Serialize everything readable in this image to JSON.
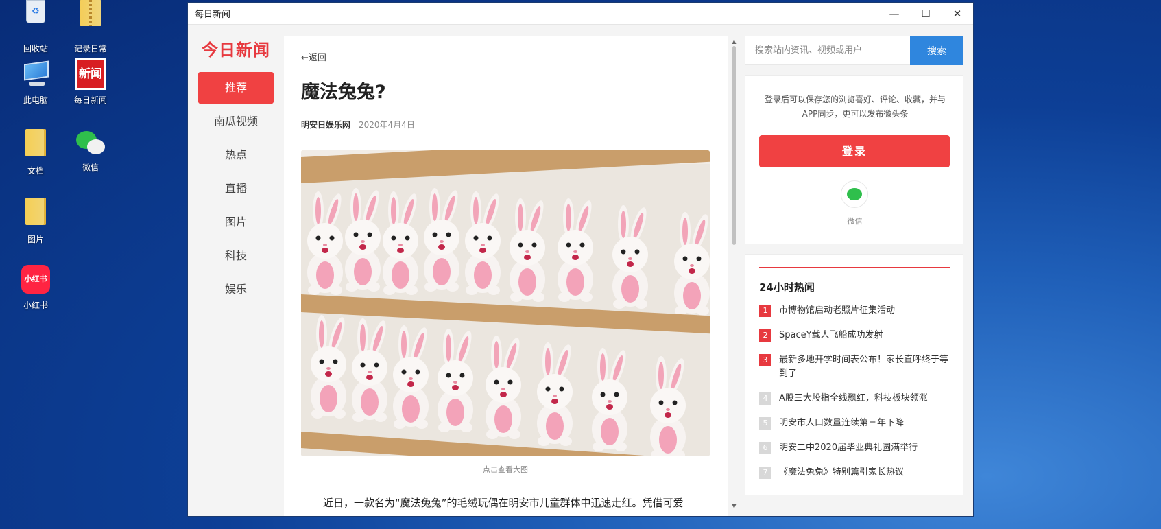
{
  "desktop": {
    "icons": [
      {
        "label": "回收站"
      },
      {
        "label": "记录日常"
      },
      {
        "label": "此电脑"
      },
      {
        "label": "每日新闻"
      },
      {
        "label": "文档"
      },
      {
        "label": "微信"
      },
      {
        "label": "图片"
      },
      {
        "label": "小红书"
      }
    ],
    "news_logo_text": "新闻",
    "xhs_logo_text": "小红书"
  },
  "window": {
    "title": "每日新闻",
    "controls": {
      "minimize": "—",
      "maximize": "☐",
      "close": "✕"
    }
  },
  "leftnav": {
    "brand": "今日新闻",
    "items": [
      {
        "label": "推荐",
        "active": true
      },
      {
        "label": "南瓜视频"
      },
      {
        "label": "热点"
      },
      {
        "label": "直播"
      },
      {
        "label": "图片"
      },
      {
        "label": "科技"
      },
      {
        "label": "娱乐"
      }
    ]
  },
  "article": {
    "back_label": "返回",
    "title": "魔法兔兔?",
    "source": "明安日娱乐网",
    "date": "2020年4月4日",
    "image_caption": "点击查看大图",
    "first_paragraph": "近日，一款名为“魔法兔兔”的毛绒玩偶在明安市儿童群体中迅速走红。凭借可爱"
  },
  "search": {
    "placeholder": "搜索站内资讯、视频或用户",
    "button_label": "搜索"
  },
  "login": {
    "description": "登录后可以保存您的浏览喜好、评论、收藏，并与APP同步，更可以发布微头条",
    "button_label": "登录",
    "wechat_label": "微信"
  },
  "hot": {
    "title": "24小时热闻",
    "items": [
      {
        "rank": "1",
        "text": "市博物馆启动老照片征集活动"
      },
      {
        "rank": "2",
        "text": "SpaceY载人飞船成功发射"
      },
      {
        "rank": "3",
        "text": "最新多地开学时间表公布！家长直呼终于等到了"
      },
      {
        "rank": "4",
        "text": "A股三大股指全线飘红，科技板块领涨"
      },
      {
        "rank": "5",
        "text": "明安市人口数量连续第三年下降"
      },
      {
        "rank": "6",
        "text": "明安二中2020届毕业典礼圆满举行"
      },
      {
        "rank": "7",
        "text": "《魔法兔兔》特别篇引家长热议"
      }
    ]
  }
}
